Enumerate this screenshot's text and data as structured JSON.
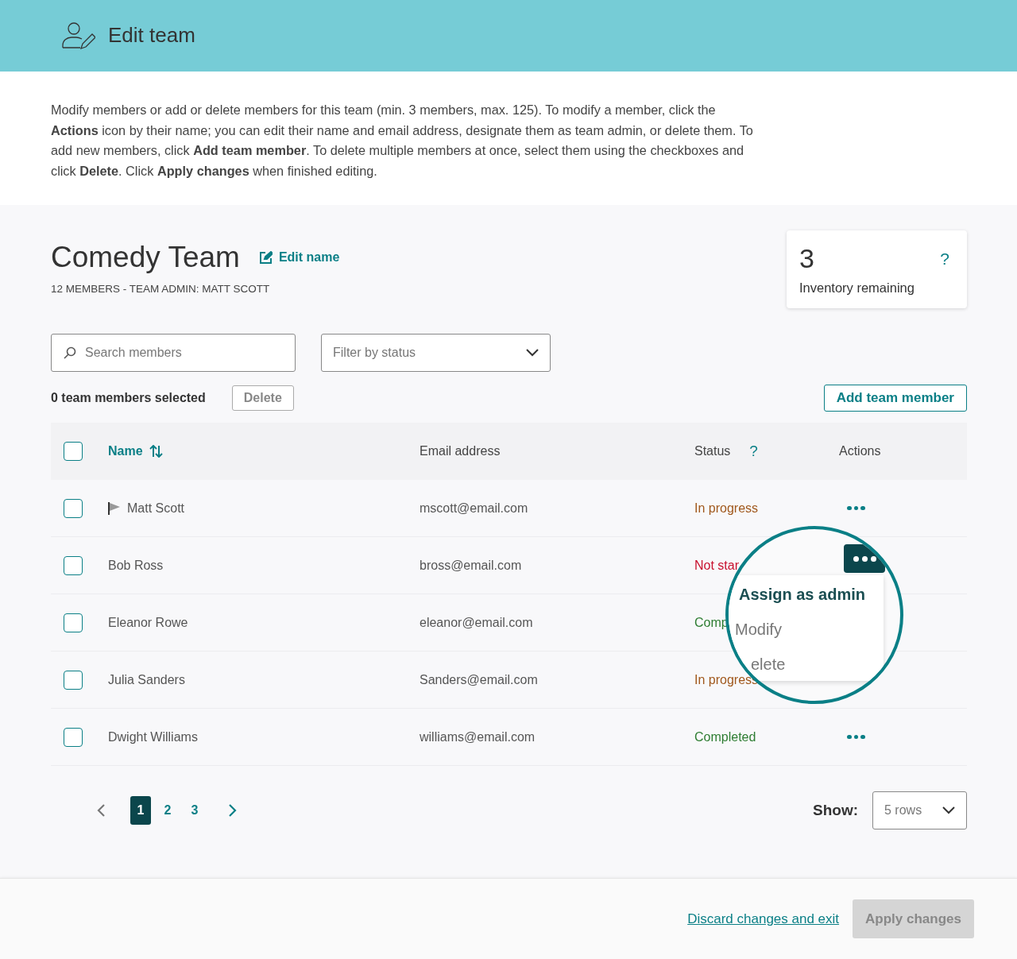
{
  "header": {
    "title": "Edit team"
  },
  "intro": "Modify members or add or delete members for this team (min. 3 members, max. 125). To modify a member, click the **Actions** icon by their name; you can edit their name and email address, designate them as team admin, or delete them. To add new members, click **Add team member**. To delete multiple members at once, select them using the checkboxes and click **Delete**. Click **Apply changes** when finished editing.",
  "team": {
    "name": "Comedy Team",
    "edit_label": "Edit name",
    "subtitle": "12 MEMBERS - TEAM ADMIN: MATT SCOTT"
  },
  "inventory": {
    "count": "3",
    "label": "Inventory remaining",
    "help": "?"
  },
  "search": {
    "placeholder": "Search members"
  },
  "filter": {
    "placeholder": "Filter by status"
  },
  "selection": {
    "text": "0 team members selected",
    "delete_label": "Delete",
    "delete_disabled": true
  },
  "add_button": "Add team member",
  "table": {
    "select_all_checked": false,
    "columns": [
      {
        "label": "Name"
      },
      {
        "label": "Email address"
      },
      {
        "label": "Status",
        "help": "?"
      },
      {
        "label": "Actions"
      }
    ],
    "rows": [
      {
        "checked": false,
        "admin": true,
        "name": "Matt Scott",
        "email": "mscott@email.com",
        "status": "In progress",
        "color": "#a0581c"
      },
      {
        "checked": false,
        "admin": false,
        "name": "Bob Ross",
        "email": "bross@email.com",
        "status": "Not star",
        "color": "#c8102e"
      },
      {
        "checked": false,
        "admin": false,
        "name": "Eleanor Rowe",
        "email": "eleanor@email.com",
        "status": "Comp",
        "color": "#2e7d32"
      },
      {
        "checked": false,
        "admin": false,
        "name": "Julia Sanders",
        "email": "Sanders@email.com",
        "status": "In progress",
        "color": "#a0581c"
      },
      {
        "checked": false,
        "admin": false,
        "name": "Dwight Williams",
        "email": "williams@email.com",
        "status": "Completed",
        "color": "#2e7d32"
      }
    ]
  },
  "magnifier": {
    "menu": [
      {
        "label": "Assign as admin",
        "selected": true
      },
      {
        "label": "Modify",
        "selected": false
      },
      {
        "label": "elete",
        "selected": false
      }
    ]
  },
  "pagination": {
    "pages": [
      {
        "label": "1",
        "selected": true
      },
      {
        "label": "2",
        "selected": false
      },
      {
        "label": "3",
        "selected": false
      }
    ],
    "prev_disabled": true
  },
  "rows_select": {
    "label": "Show:",
    "value": "5 rows"
  },
  "footer": {
    "discard": "Discard changes and exit",
    "apply": "Apply changes",
    "apply_disabled": true
  }
}
